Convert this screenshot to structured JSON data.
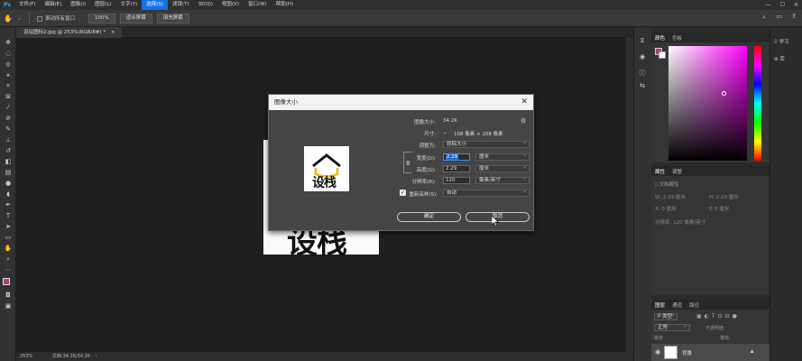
{
  "menu": {
    "logo": "Ps",
    "items": [
      "文件(F)",
      "编辑(E)",
      "图像(I)",
      "图层(L)",
      "文字(Y)",
      "选择(S)",
      "滤镜(T)",
      "3D(D)",
      "视图(V)",
      "窗口(W)",
      "帮助(H)"
    ],
    "active_index": 5
  },
  "window": {
    "minimize": "—",
    "maximize": "☐",
    "close": "✕"
  },
  "options": {
    "checkbox_label": "滚动所有窗口",
    "zoom_button": "100%",
    "fit_button": "适合屏幕",
    "fill_button": "填充屏幕"
  },
  "document": {
    "tab_title": "设站图标2.jpg @ 253%(RGB/8#) *",
    "tab_close": "×"
  },
  "status": {
    "zoom": "253%",
    "doc_info": "文档:34.2K/34.2K"
  },
  "panels": {
    "color_tabs": [
      "颜色",
      "色板"
    ],
    "props_tabs": [
      "属性",
      "调整"
    ],
    "props_doc_label": "文档属性",
    "props_w": "W: 2.29 厘米",
    "props_h": "H: 2.29 厘米",
    "props_x": "X: 0 厘米",
    "props_y": "Y: 0 厘米",
    "props_res": "分辨率: 120 像素/英寸",
    "layers_tabs": [
      "图层",
      "通道",
      "路径"
    ],
    "layers_kind": "P 类型",
    "layers_mode": "正常",
    "layers_opacity": "不透明度:",
    "layers_lock": "锁定:",
    "layers_fill": "填充:",
    "layer_name": "背景"
  },
  "right_strip": {
    "learn": "学习",
    "library": "库"
  },
  "dialog": {
    "title": "图像大小",
    "close": "✕",
    "image_size_label": "图像大小:",
    "image_size_value": "34.2K",
    "dimensions_label": "尺寸:",
    "dimensions_value": "108 像素 × 108 像素",
    "fit_to_label": "调整为:",
    "fit_to_value": "原稿大小",
    "width_label": "宽度(D):",
    "width_value": "2.29",
    "width_unit": "厘米",
    "height_label": "高度(G):",
    "height_value": "2.29",
    "height_unit": "厘米",
    "resolution_label": "分辨率(R):",
    "resolution_value": "120",
    "resolution_unit": "像素/英寸",
    "resample_label": "重新采样(S):",
    "resample_value": "自动",
    "ok": "确定",
    "cancel": "取消"
  },
  "canvas_image": {
    "logo_text": "设栈",
    "large_text": "设栈"
  },
  "colors": {
    "accent": "#1473e6",
    "foreground_swatch": "#a0457a",
    "background_swatch": "#ffffff",
    "logo_yellow": "#f2b705"
  }
}
